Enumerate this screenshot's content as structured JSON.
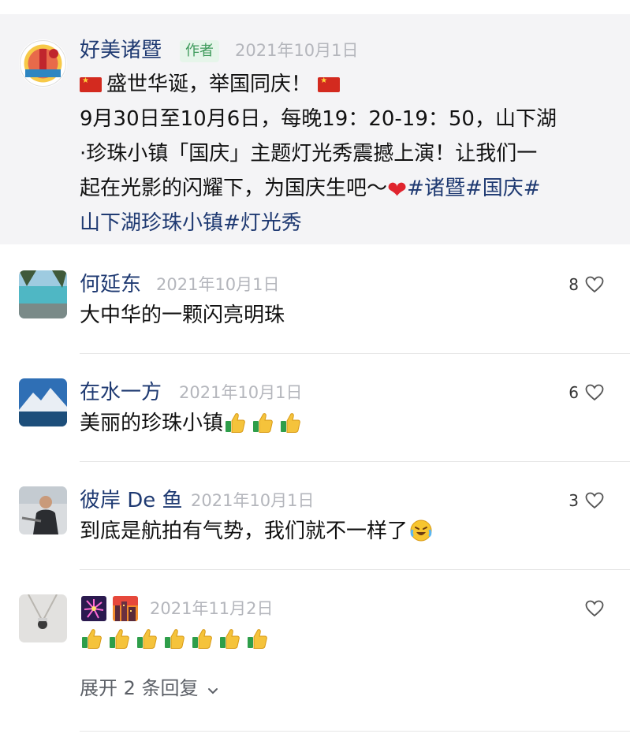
{
  "post": {
    "author": "好美诸暨",
    "badge": "作者",
    "date": "2021年10月1日",
    "line1": "盛世华诞，举国同庆！",
    "line2": "9月30日至10月6日，每晚19：20-19：50，山下湖",
    "line3": "·珍珠小镇「国庆」主题灯光秀震撼上演！让我们一",
    "line4_text": "起在光影的闪耀下，为国庆生吧～",
    "line4_heart": "❤",
    "line4_tags": "#诸暨#国庆#",
    "line5": "山下湖珍珠小镇#灯光秀"
  },
  "comments": [
    {
      "name": "何延东",
      "date": "2021年10月1日",
      "text": "大中华的一颗闪亮明珠",
      "likes": "8"
    },
    {
      "name": "在水一方",
      "date": "2021年10月1日",
      "text": "美丽的珍珠小镇",
      "likes": "6"
    },
    {
      "name": "彼岸 De 鱼",
      "date": "2021年10月1日",
      "text": "到底是航拍有气势，我们就不一样了",
      "likes": "3"
    },
    {
      "name": "",
      "date": "2021年11月2日",
      "text": "",
      "likes": ""
    }
  ],
  "expand_replies": "展开 2 条回复",
  "icons": {
    "like": "heart-outline-icon",
    "expand": "chevron-down-icon",
    "thumbs": "thumbs-up-emoji",
    "cry": "laughing-crying-emoji",
    "flag": "china-flag-emoji"
  },
  "colors": {
    "name": "#1f3a72",
    "date": "#b4b6bc",
    "badge_bg": "#e6f5ea",
    "badge_text": "#3e9a5b",
    "post_bg": "#f4f4f6"
  }
}
